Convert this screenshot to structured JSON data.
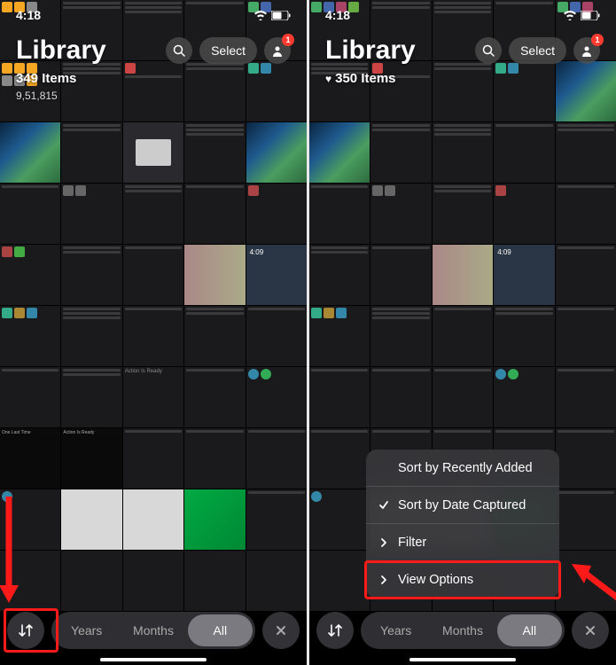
{
  "status": {
    "time": "4:18",
    "wifi": "strong",
    "battery": "half"
  },
  "left_phone": {
    "title": "Library",
    "item_count": "349 Items",
    "sub_count": "9,51,815",
    "profile_badge": "1",
    "select_label": "Select"
  },
  "right_phone": {
    "title": "Library",
    "item_count": "350 Items",
    "profile_badge": "1",
    "select_label": "Select",
    "popup": {
      "items": [
        {
          "icon": "",
          "label": "Sort by Recently Added"
        },
        {
          "icon": "check",
          "label": "Sort by Date Captured"
        },
        {
          "icon": "chevron",
          "label": "Filter"
        },
        {
          "icon": "chevron",
          "label": "View Options"
        }
      ]
    }
  },
  "segments": {
    "years": "Years",
    "months": "Months",
    "all": "All"
  }
}
